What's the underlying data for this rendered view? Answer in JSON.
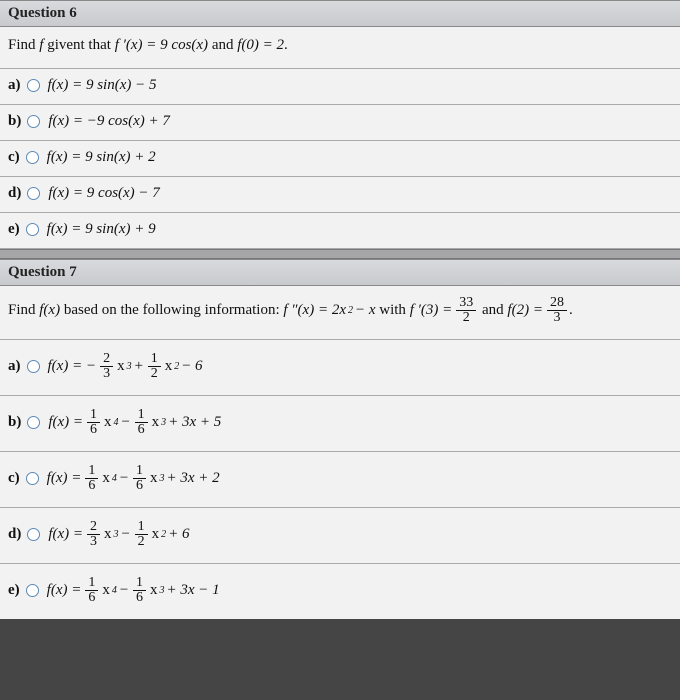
{
  "q6": {
    "header": "Question 6",
    "prompt_pre": "Find ",
    "prompt_f": "f",
    "prompt_mid": " givent that ",
    "prompt_deriv": "f ′(x) = 9 cos(x)",
    "prompt_and": " and ",
    "prompt_cond": "f(0) = 2",
    "prompt_end": ".",
    "choices": [
      {
        "label": "a)",
        "expr": "f(x) = 9 sin(x) − 5"
      },
      {
        "label": "b)",
        "expr": "f(x) = −9 cos(x) + 7"
      },
      {
        "label": "c)",
        "expr": "f(x) = 9 sin(x) + 2"
      },
      {
        "label": "d)",
        "expr": "f(x) = 9 cos(x) − 7"
      },
      {
        "label": "e)",
        "expr": "f(x) = 9 sin(x) + 9"
      }
    ]
  },
  "q7": {
    "header": "Question 7",
    "prompt_pre": "Find ",
    "prompt_fx": "f(x)",
    "prompt_mid": " based on the following information: ",
    "prompt_d2": "f ″(x) = 2x",
    "prompt_sq": "2",
    "prompt_d2b": " − x",
    "prompt_with": " with ",
    "prompt_fp": "f ′(3) = ",
    "frac1_num": "33",
    "frac1_den": "2",
    "prompt_and": " and ",
    "prompt_f2": "f(2) = ",
    "frac2_num": "28",
    "frac2_den": "3",
    "prompt_end": ".",
    "choices": [
      {
        "label": "a)",
        "lead": "f(x) = − ",
        "a_num": "2",
        "a_den": "3",
        "a_pow": "3",
        "op1": " + ",
        "b_num": "1",
        "b_den": "2",
        "b_pow": "2",
        "tail": " − 6"
      },
      {
        "label": "b)",
        "lead": "f(x) = ",
        "a_num": "1",
        "a_den": "6",
        "a_pow": "4",
        "op1": " − ",
        "b_num": "1",
        "b_den": "6",
        "b_pow": "3",
        "tail": " + 3x + 5"
      },
      {
        "label": "c)",
        "lead": "f(x) = ",
        "a_num": "1",
        "a_den": "6",
        "a_pow": "4",
        "op1": " − ",
        "b_num": "1",
        "b_den": "6",
        "b_pow": "3",
        "tail": " + 3x + 2"
      },
      {
        "label": "d)",
        "lead": "f(x) = ",
        "a_num": "2",
        "a_den": "3",
        "a_pow": "3",
        "op1": " − ",
        "b_num": "1",
        "b_den": "2",
        "b_pow": "2",
        "tail": " + 6"
      },
      {
        "label": "e)",
        "lead": "f(x) = ",
        "a_num": "1",
        "a_den": "6",
        "a_pow": "4",
        "op1": " − ",
        "b_num": "1",
        "b_den": "6",
        "b_pow": "3",
        "tail": " + 3x − 1"
      }
    ]
  }
}
